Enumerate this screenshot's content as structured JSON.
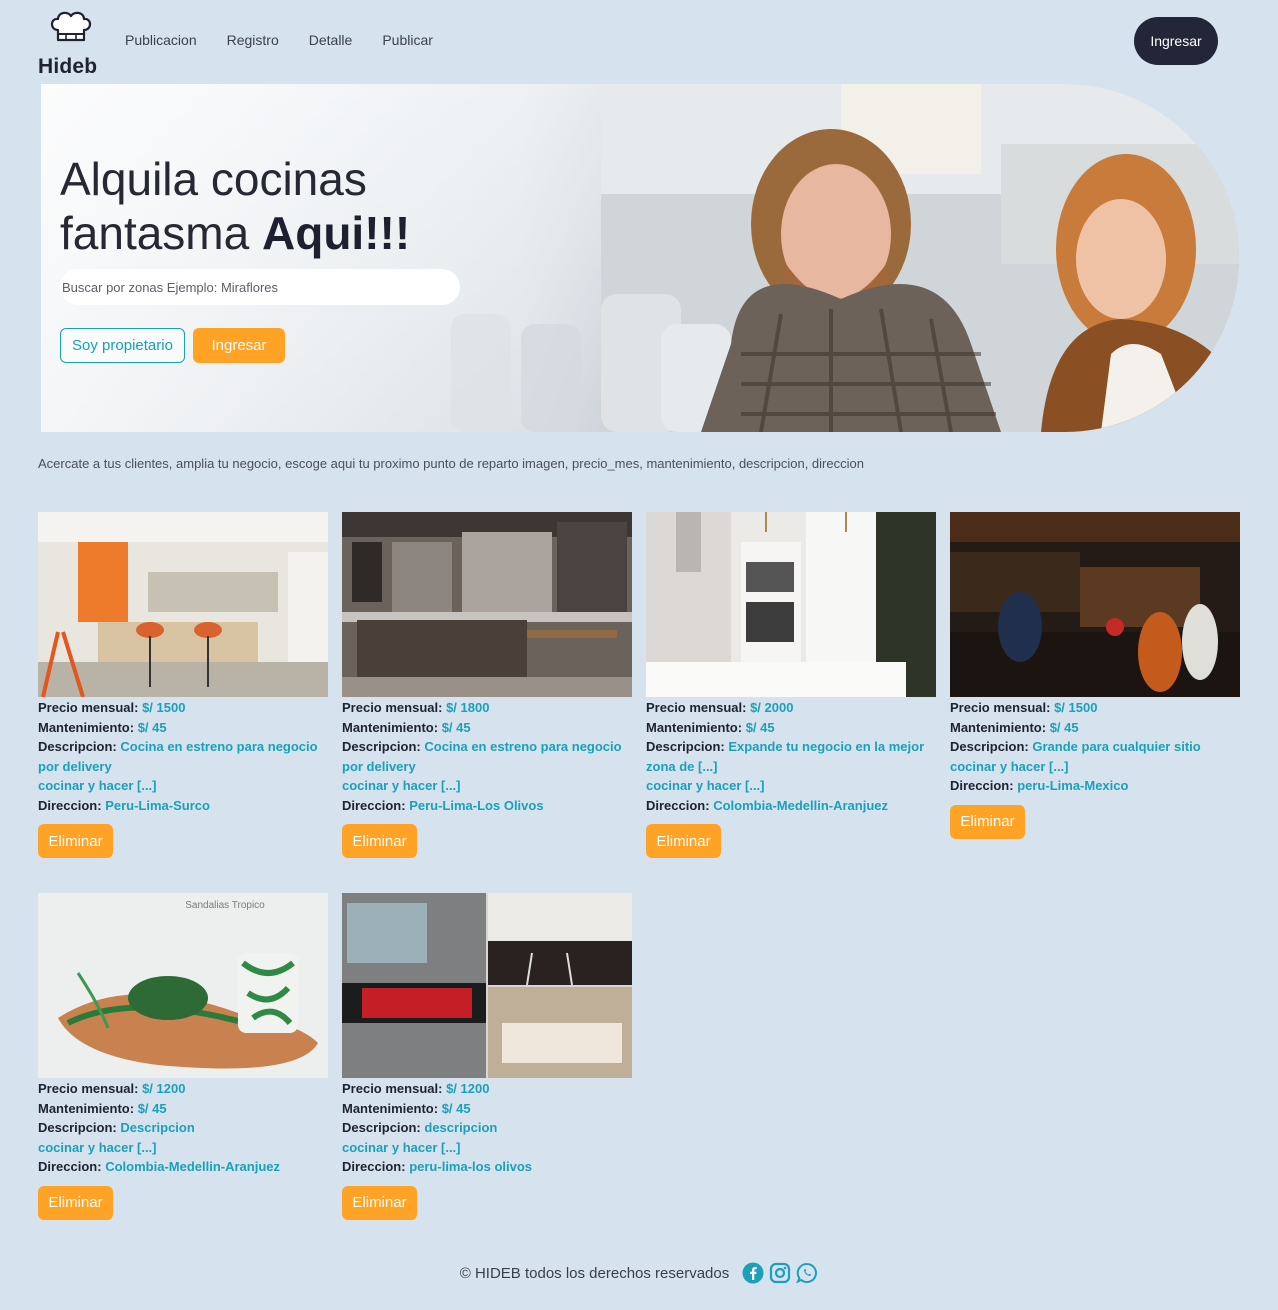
{
  "brand": {
    "name": "Hideb"
  },
  "nav": {
    "links": [
      "Publicacion",
      "Registro",
      "Detalle",
      "Publicar"
    ],
    "login": "Ingresar"
  },
  "hero": {
    "title_line1": "Alquila cocinas",
    "title_line2": "fantasma",
    "title_bold": "Aqui!!!",
    "search_placeholder": "Buscar por zonas Ejemplo: Miraflores",
    "owner_button": "Soy propietario",
    "login_button": "Ingresar"
  },
  "intro": "Acercate a tus clientes, amplia tu negocio, escoge aqui tu proximo punto de reparto imagen, precio_mes, mantenimiento, descripcion, direccion",
  "labels": {
    "price": "Precio mensual:",
    "maintenance": "Mantenimiento:",
    "description": "Descripcion:",
    "address": "Direccion:",
    "delete": "Eliminar",
    "more": "cocinar y hacer [...]"
  },
  "listings": [
    {
      "price": "$/ 1500",
      "maintenance": "$/ 45",
      "description": "Cocina en estreno para negocio por delivery",
      "address": "Peru-Lima-Surco",
      "image": "orange-kitchen"
    },
    {
      "price": "$/ 1800",
      "maintenance": "$/ 45",
      "description": "Cocina en estreno para negocio por delivery",
      "address": "Peru-Lima-Los Olivos",
      "image": "dark-wood-kitchen"
    },
    {
      "price": "$/ 2000",
      "maintenance": "$/ 45",
      "description": "Expande tu negocio en la mejor zona de [...]",
      "address": "Colombia-Medellin-Aranjuez",
      "image": "white-kitchen"
    },
    {
      "price": "$/ 1500",
      "maintenance": "$/ 45",
      "description": "Grande para cualquier sitio",
      "address": "peru-Lima-Mexico",
      "image": "busy-bar"
    },
    {
      "price": "$/ 1200",
      "maintenance": "$/ 45",
      "description": "Descripcion",
      "address": "Colombia-Medellin-Aranjuez",
      "image": "sandal",
      "image_caption": "Sandalias Tropico"
    },
    {
      "price": "$/ 1200",
      "maintenance": "$/ 45",
      "description": "descripcion",
      "address": "peru-lima-los olivos",
      "image": "kitchen-collage"
    }
  ],
  "footer": {
    "text": "© HIDEB todos los derechos reservados",
    "icons": [
      "facebook-icon",
      "instagram-icon",
      "whatsapp-icon"
    ]
  },
  "colors": {
    "background": "#d6e3ee",
    "accent_orange": "#ffa326",
    "accent_teal": "#1aa0b9",
    "dark": "#232538"
  }
}
